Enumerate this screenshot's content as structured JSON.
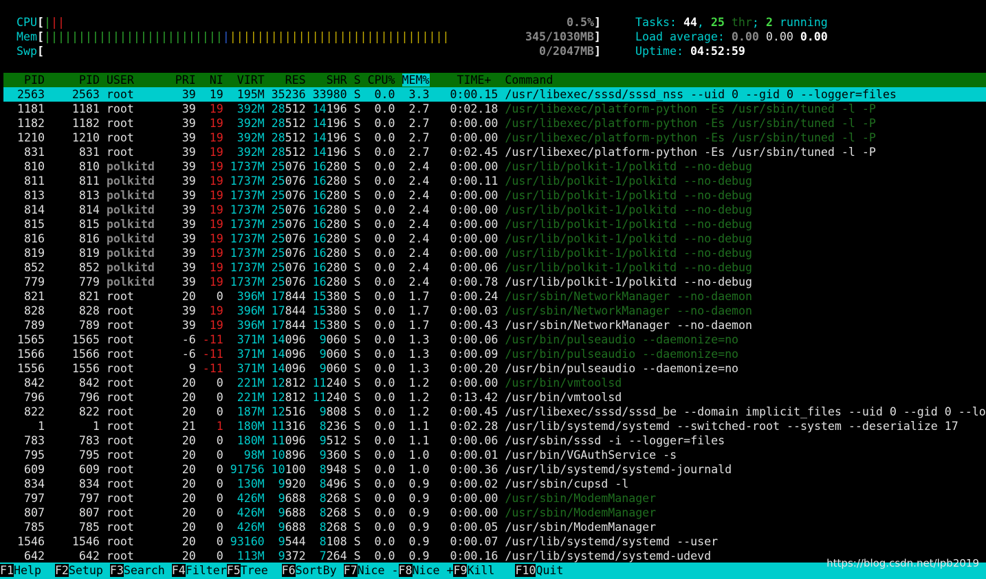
{
  "meters": {
    "cpu": {
      "label": "CPU",
      "bar_user": "|",
      "bar_sys": "||",
      "value": "0.5%"
    },
    "mem": {
      "label": "Mem",
      "bar_used": "||||||||||||||||||||||||||||||||||||||||||||||||||||||||||||||||||||",
      "bar_buffers": "|",
      "bar_cache": "||||||||||||||||||||||||||||||||||||||||||||||||||||||||||||||||||||||||||||||||||||||||||||||",
      "value": "345/1030MB"
    },
    "swp": {
      "label": "Swp",
      "value": "0/2047MB"
    }
  },
  "summary": {
    "tasks_label": "Tasks: ",
    "tasks": "44",
    "tasks_sep": ", ",
    "threads": "25",
    "thr_label": " thr",
    "running_sep": "; ",
    "running": "2",
    "running_label": " running",
    "load_label": "Load average: ",
    "load1": "0.00",
    "load5": "0.00",
    "load15": "0.00",
    "uptime_label": "Uptime: ",
    "uptime": "04:52:59"
  },
  "columns": {
    "pid": "PID",
    "tgid": "PID",
    "user": "USER",
    "pri": "PRI",
    "ni": "NI",
    "virt": "VIRT",
    "res": "RES",
    "shr": "SHR",
    "s": "S",
    "cpu": "CPU%",
    "mem": "MEM%",
    "time": "TIME+",
    "command": "Command"
  },
  "processes": [
    {
      "pid": "2563",
      "tgid": "2563",
      "user": "root",
      "pri": "39",
      "ni": "19",
      "virt": "195M",
      "res": "35236",
      "shr": "33980",
      "s": "S",
      "cpu": "0.0",
      "mem": "3.3",
      "time": "0:00.15",
      "command": "/usr/libexec/sssd/sssd_nss --uid 0 --gid 0 --logger=files",
      "thread": false,
      "selected": true
    },
    {
      "pid": "1181",
      "tgid": "1181",
      "user": "root",
      "pri": "39",
      "ni": "19",
      "virt": "392M",
      "res": "28512",
      "shr": "14196",
      "s": "S",
      "cpu": "0.0",
      "mem": "2.7",
      "time": "0:02.18",
      "command": "/usr/libexec/platform-python -Es /usr/sbin/tuned -l -P",
      "thread": true
    },
    {
      "pid": "1182",
      "tgid": "1182",
      "user": "root",
      "pri": "39",
      "ni": "19",
      "virt": "392M",
      "res": "28512",
      "shr": "14196",
      "s": "S",
      "cpu": "0.0",
      "mem": "2.7",
      "time": "0:00.00",
      "command": "/usr/libexec/platform-python -Es /usr/sbin/tuned -l -P",
      "thread": true
    },
    {
      "pid": "1210",
      "tgid": "1210",
      "user": "root",
      "pri": "39",
      "ni": "19",
      "virt": "392M",
      "res": "28512",
      "shr": "14196",
      "s": "S",
      "cpu": "0.0",
      "mem": "2.7",
      "time": "0:00.00",
      "command": "/usr/libexec/platform-python -Es /usr/sbin/tuned -l -P",
      "thread": true
    },
    {
      "pid": "831",
      "tgid": "831",
      "user": "root",
      "pri": "39",
      "ni": "19",
      "virt": "392M",
      "res": "28512",
      "shr": "14196",
      "s": "S",
      "cpu": "0.0",
      "mem": "2.7",
      "time": "0:02.45",
      "command": "/usr/libexec/platform-python -Es /usr/sbin/tuned -l -P",
      "thread": false
    },
    {
      "pid": "810",
      "tgid": "810",
      "user": "polkitd",
      "pri": "39",
      "ni": "19",
      "virt": "1737M",
      "res": "25076",
      "shr": "16280",
      "s": "S",
      "cpu": "0.0",
      "mem": "2.4",
      "time": "0:00.00",
      "command": "/usr/lib/polkit-1/polkitd --no-debug",
      "thread": true
    },
    {
      "pid": "811",
      "tgid": "811",
      "user": "polkitd",
      "pri": "39",
      "ni": "19",
      "virt": "1737M",
      "res": "25076",
      "shr": "16280",
      "s": "S",
      "cpu": "0.0",
      "mem": "2.4",
      "time": "0:00.11",
      "command": "/usr/lib/polkit-1/polkitd --no-debug",
      "thread": true
    },
    {
      "pid": "813",
      "tgid": "813",
      "user": "polkitd",
      "pri": "39",
      "ni": "19",
      "virt": "1737M",
      "res": "25076",
      "shr": "16280",
      "s": "S",
      "cpu": "0.0",
      "mem": "2.4",
      "time": "0:00.00",
      "command": "/usr/lib/polkit-1/polkitd --no-debug",
      "thread": true
    },
    {
      "pid": "814",
      "tgid": "814",
      "user": "polkitd",
      "pri": "39",
      "ni": "19",
      "virt": "1737M",
      "res": "25076",
      "shr": "16280",
      "s": "S",
      "cpu": "0.0",
      "mem": "2.4",
      "time": "0:00.00",
      "command": "/usr/lib/polkit-1/polkitd --no-debug",
      "thread": true
    },
    {
      "pid": "815",
      "tgid": "815",
      "user": "polkitd",
      "pri": "39",
      "ni": "19",
      "virt": "1737M",
      "res": "25076",
      "shr": "16280",
      "s": "S",
      "cpu": "0.0",
      "mem": "2.4",
      "time": "0:00.00",
      "command": "/usr/lib/polkit-1/polkitd --no-debug",
      "thread": true
    },
    {
      "pid": "816",
      "tgid": "816",
      "user": "polkitd",
      "pri": "39",
      "ni": "19",
      "virt": "1737M",
      "res": "25076",
      "shr": "16280",
      "s": "S",
      "cpu": "0.0",
      "mem": "2.4",
      "time": "0:00.00",
      "command": "/usr/lib/polkit-1/polkitd --no-debug",
      "thread": true
    },
    {
      "pid": "819",
      "tgid": "819",
      "user": "polkitd",
      "pri": "39",
      "ni": "19",
      "virt": "1737M",
      "res": "25076",
      "shr": "16280",
      "s": "S",
      "cpu": "0.0",
      "mem": "2.4",
      "time": "0:00.00",
      "command": "/usr/lib/polkit-1/polkitd --no-debug",
      "thread": true
    },
    {
      "pid": "852",
      "tgid": "852",
      "user": "polkitd",
      "pri": "39",
      "ni": "19",
      "virt": "1737M",
      "res": "25076",
      "shr": "16280",
      "s": "S",
      "cpu": "0.0",
      "mem": "2.4",
      "time": "0:00.06",
      "command": "/usr/lib/polkit-1/polkitd --no-debug",
      "thread": true
    },
    {
      "pid": "779",
      "tgid": "779",
      "user": "polkitd",
      "pri": "39",
      "ni": "19",
      "virt": "1737M",
      "res": "25076",
      "shr": "16280",
      "s": "S",
      "cpu": "0.0",
      "mem": "2.4",
      "time": "0:00.78",
      "command": "/usr/lib/polkit-1/polkitd --no-debug",
      "thread": false
    },
    {
      "pid": "821",
      "tgid": "821",
      "user": "root",
      "pri": "20",
      "ni": "0",
      "virt": "396M",
      "res": "17844",
      "shr": "15380",
      "s": "S",
      "cpu": "0.0",
      "mem": "1.7",
      "time": "0:00.24",
      "command": "/usr/sbin/NetworkManager --no-daemon",
      "thread": true
    },
    {
      "pid": "828",
      "tgid": "828",
      "user": "root",
      "pri": "39",
      "ni": "19",
      "virt": "396M",
      "res": "17844",
      "shr": "15380",
      "s": "S",
      "cpu": "0.0",
      "mem": "1.7",
      "time": "0:00.03",
      "command": "/usr/sbin/NetworkManager --no-daemon",
      "thread": true
    },
    {
      "pid": "789",
      "tgid": "789",
      "user": "root",
      "pri": "39",
      "ni": "19",
      "virt": "396M",
      "res": "17844",
      "shr": "15380",
      "s": "S",
      "cpu": "0.0",
      "mem": "1.7",
      "time": "0:00.43",
      "command": "/usr/sbin/NetworkManager --no-daemon",
      "thread": false
    },
    {
      "pid": "1565",
      "tgid": "1565",
      "user": "root",
      "pri": "-6",
      "ni": "-11",
      "virt": "371M",
      "res": "14096",
      "shr": "9060",
      "s": "S",
      "cpu": "0.0",
      "mem": "1.3",
      "time": "0:00.06",
      "command": "/usr/bin/pulseaudio --daemonize=no",
      "thread": true
    },
    {
      "pid": "1566",
      "tgid": "1566",
      "user": "root",
      "pri": "-6",
      "ni": "-11",
      "virt": "371M",
      "res": "14096",
      "shr": "9060",
      "s": "S",
      "cpu": "0.0",
      "mem": "1.3",
      "time": "0:00.09",
      "command": "/usr/bin/pulseaudio --daemonize=no",
      "thread": true
    },
    {
      "pid": "1556",
      "tgid": "1556",
      "user": "root",
      "pri": "9",
      "ni": "-11",
      "virt": "371M",
      "res": "14096",
      "shr": "9060",
      "s": "S",
      "cpu": "0.0",
      "mem": "1.3",
      "time": "0:00.20",
      "command": "/usr/bin/pulseaudio --daemonize=no",
      "thread": false
    },
    {
      "pid": "842",
      "tgid": "842",
      "user": "root",
      "pri": "20",
      "ni": "0",
      "virt": "221M",
      "res": "12812",
      "shr": "11240",
      "s": "S",
      "cpu": "0.0",
      "mem": "1.2",
      "time": "0:00.00",
      "command": "/usr/bin/vmtoolsd",
      "thread": true
    },
    {
      "pid": "796",
      "tgid": "796",
      "user": "root",
      "pri": "20",
      "ni": "0",
      "virt": "221M",
      "res": "12812",
      "shr": "11240",
      "s": "S",
      "cpu": "0.0",
      "mem": "1.2",
      "time": "0:13.42",
      "command": "/usr/bin/vmtoolsd",
      "thread": false
    },
    {
      "pid": "822",
      "tgid": "822",
      "user": "root",
      "pri": "20",
      "ni": "0",
      "virt": "187M",
      "res": "12516",
      "shr": "9808",
      "s": "S",
      "cpu": "0.0",
      "mem": "1.2",
      "time": "0:00.45",
      "command": "/usr/libexec/sssd/sssd_be --domain implicit_files --uid 0 --gid 0 --lo",
      "thread": false
    },
    {
      "pid": "1",
      "tgid": "1",
      "user": "root",
      "pri": "21",
      "ni": "1",
      "virt": "180M",
      "res": "11316",
      "shr": "8236",
      "s": "S",
      "cpu": "0.0",
      "mem": "1.1",
      "time": "0:02.28",
      "command": "/usr/lib/systemd/systemd --switched-root --system --deserialize 17",
      "thread": false
    },
    {
      "pid": "783",
      "tgid": "783",
      "user": "root",
      "pri": "20",
      "ni": "0",
      "virt": "180M",
      "res": "11096",
      "shr": "9512",
      "s": "S",
      "cpu": "0.0",
      "mem": "1.1",
      "time": "0:00.06",
      "command": "/usr/sbin/sssd -i --logger=files",
      "thread": false
    },
    {
      "pid": "795",
      "tgid": "795",
      "user": "root",
      "pri": "20",
      "ni": "0",
      "virt": "98M",
      "res": "10896",
      "shr": "9360",
      "s": "S",
      "cpu": "0.0",
      "mem": "1.0",
      "time": "0:00.01",
      "command": "/usr/bin/VGAuthService -s",
      "thread": false
    },
    {
      "pid": "609",
      "tgid": "609",
      "user": "root",
      "pri": "20",
      "ni": "0",
      "virt": "91756",
      "res": "10100",
      "shr": "8948",
      "s": "S",
      "cpu": "0.0",
      "mem": "1.0",
      "time": "0:00.36",
      "command": "/usr/lib/systemd/systemd-journald",
      "thread": false
    },
    {
      "pid": "834",
      "tgid": "834",
      "user": "root",
      "pri": "20",
      "ni": "0",
      "virt": "130M",
      "res": "9920",
      "shr": "8496",
      "s": "S",
      "cpu": "0.0",
      "mem": "0.9",
      "time": "0:00.02",
      "command": "/usr/sbin/cupsd -l",
      "thread": false
    },
    {
      "pid": "797",
      "tgid": "797",
      "user": "root",
      "pri": "20",
      "ni": "0",
      "virt": "426M",
      "res": "9688",
      "shr": "8268",
      "s": "S",
      "cpu": "0.0",
      "mem": "0.9",
      "time": "0:00.00",
      "command": "/usr/sbin/ModemManager",
      "thread": true
    },
    {
      "pid": "807",
      "tgid": "807",
      "user": "root",
      "pri": "20",
      "ni": "0",
      "virt": "426M",
      "res": "9688",
      "shr": "8268",
      "s": "S",
      "cpu": "0.0",
      "mem": "0.9",
      "time": "0:00.00",
      "command": "/usr/sbin/ModemManager",
      "thread": true
    },
    {
      "pid": "785",
      "tgid": "785",
      "user": "root",
      "pri": "20",
      "ni": "0",
      "virt": "426M",
      "res": "9688",
      "shr": "8268",
      "s": "S",
      "cpu": "0.0",
      "mem": "0.9",
      "time": "0:00.05",
      "command": "/usr/sbin/ModemManager",
      "thread": false
    },
    {
      "pid": "1546",
      "tgid": "1546",
      "user": "root",
      "pri": "20",
      "ni": "0",
      "virt": "93160",
      "res": "9544",
      "shr": "8108",
      "s": "S",
      "cpu": "0.0",
      "mem": "0.9",
      "time": "0:00.07",
      "command": "/usr/lib/systemd/systemd --user",
      "thread": false
    },
    {
      "pid": "642",
      "tgid": "642",
      "user": "root",
      "pri": "20",
      "ni": "0",
      "virt": "113M",
      "res": "9372",
      "shr": "7264",
      "s": "S",
      "cpu": "0.0",
      "mem": "0.9",
      "time": "0:00.16",
      "command": "/usr/lib/systemd/systemd-udevd",
      "thread": false
    }
  ],
  "footer": [
    {
      "key": "F1",
      "label": "Help"
    },
    {
      "key": "F2",
      "label": "Setup"
    },
    {
      "key": "F3",
      "label": "Search"
    },
    {
      "key": "F4",
      "label": "Filter"
    },
    {
      "key": "F5",
      "label": "Tree"
    },
    {
      "key": "F6",
      "label": "SortBy"
    },
    {
      "key": "F7",
      "label": "Nice -"
    },
    {
      "key": "F8",
      "label": "Nice +"
    },
    {
      "key": "F9",
      "label": "Kill"
    },
    {
      "key": "F10",
      "label": "Quit"
    }
  ],
  "watermark": "https://blog.csdn.net/lpb2019",
  "colors": {
    "background": "#000000",
    "header_bar": "#077007",
    "selection": "#00cdcd",
    "meter_label": "#00cdcd",
    "thread_text": "#1f6e1f",
    "niced": "#e02020",
    "kernel_user": "#8a8a8a"
  }
}
